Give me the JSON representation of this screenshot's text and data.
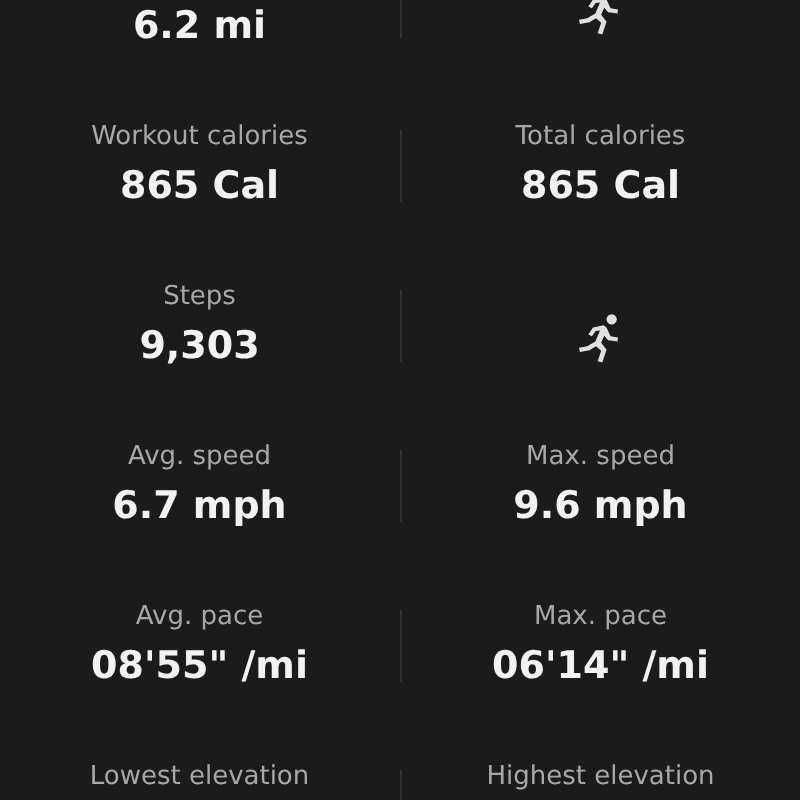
{
  "rows": [
    {
      "cells": [
        {
          "kind": "stat",
          "value": "6.2 mi"
        },
        {
          "kind": "icon"
        }
      ]
    },
    {
      "cells": [
        {
          "kind": "stat",
          "label": "Workout calories",
          "value": "865 Cal"
        },
        {
          "kind": "stat",
          "label": "Total calories",
          "value": "865 Cal"
        }
      ]
    },
    {
      "cells": [
        {
          "kind": "stat",
          "label": "Steps",
          "value": "9,303"
        },
        {
          "kind": "icon"
        }
      ]
    },
    {
      "cells": [
        {
          "kind": "stat",
          "label": "Avg. speed",
          "value": "6.7 mph"
        },
        {
          "kind": "stat",
          "label": "Max. speed",
          "value": "9.6 mph"
        }
      ]
    },
    {
      "cells": [
        {
          "kind": "stat",
          "label": "Avg. pace",
          "value": "08'55\" /mi"
        },
        {
          "kind": "stat",
          "label": "Max. pace",
          "value": "06'14\" /mi"
        }
      ]
    },
    {
      "cells": [
        {
          "kind": "stat",
          "label": "Lowest elevation"
        },
        {
          "kind": "stat",
          "label": "Highest elevation"
        }
      ]
    }
  ]
}
